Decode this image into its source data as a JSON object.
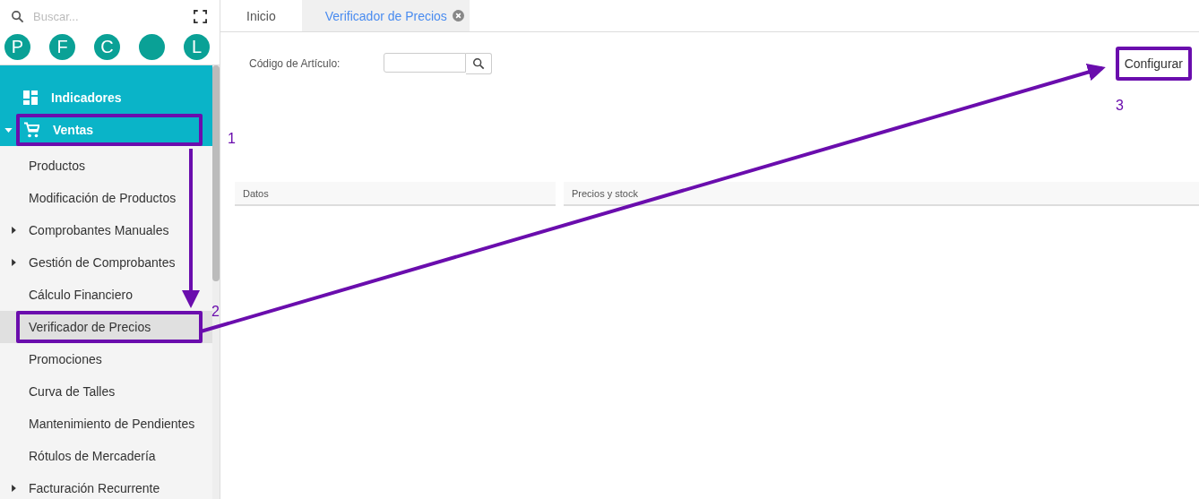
{
  "sidebar": {
    "search": {
      "placeholder": "Buscar..."
    },
    "avatars": [
      {
        "kind": "letter",
        "initial": "P"
      },
      {
        "kind": "letter",
        "initial": "F"
      },
      {
        "kind": "letter",
        "initial": "C"
      },
      {
        "kind": "blank"
      },
      {
        "kind": "letter",
        "initial": "L"
      }
    ],
    "nav": [
      {
        "label": "Indicadores",
        "kind": "dashboard",
        "highlighted": false
      },
      {
        "label": "Ventas",
        "kind": "cart",
        "expanded": true,
        "highlighted": true,
        "children": [
          {
            "label": "Productos",
            "kind": "item",
            "selected": false
          },
          {
            "label": "Modificación de Productos",
            "kind": "item",
            "selected": false
          },
          {
            "label": "Comprobantes Manuales",
            "kind": "submenu",
            "expanded": false,
            "selected": false
          },
          {
            "label": "Gestión de Comprobantes",
            "kind": "submenu",
            "expanded": false,
            "selected": false
          },
          {
            "label": "Cálculo Financiero",
            "kind": "item",
            "selected": false
          },
          {
            "label": "Verificador de Precios",
            "kind": "item",
            "selected": true,
            "highlighted": true
          },
          {
            "label": "Promociones",
            "kind": "item",
            "selected": false
          },
          {
            "label": "Curva de Talles",
            "kind": "item",
            "selected": false
          },
          {
            "label": "Mantenimiento de Pendientes",
            "kind": "item",
            "selected": false
          },
          {
            "label": "Rótulos de Mercadería",
            "kind": "item",
            "selected": false
          },
          {
            "label": "Facturación Recurrente",
            "kind": "submenu",
            "expanded": false,
            "selected": false
          }
        ]
      }
    ]
  },
  "tabs": [
    {
      "label": "Inicio",
      "selected": false,
      "closable": false
    },
    {
      "label": "Verificador de Precios",
      "selected": true,
      "closable": true
    }
  ],
  "form": {
    "label": "Código de Artículo:",
    "configure_button": {
      "label": "Configurar",
      "highlighted": true
    }
  },
  "panels": [
    {
      "title": "Datos"
    },
    {
      "title": "Precios y stock"
    }
  ],
  "annotations": [
    {
      "label": "1"
    },
    {
      "label": "2"
    },
    {
      "label": "3"
    }
  ]
}
